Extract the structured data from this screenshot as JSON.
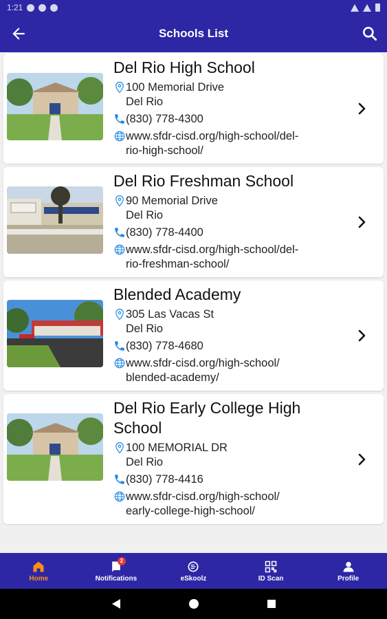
{
  "status_bar": {
    "time": "1:21"
  },
  "header": {
    "title": "Schools List"
  },
  "schools": [
    {
      "name": "Del Rio High School",
      "address_line1": "100 Memorial Drive",
      "address_line2": "Del Rio",
      "phone": "(830) 778-4300",
      "website_line1": "www.sfdr-cisd.org/high-school/del-",
      "website_line2": "rio-high-school/"
    },
    {
      "name": "Del Rio Freshman School",
      "address_line1": "90 Memorial Drive",
      "address_line2": "Del Rio",
      "phone": "(830) 778-4400",
      "website_line1": "www.sfdr-cisd.org/high-school/del-",
      "website_line2": "rio-freshman-school/"
    },
    {
      "name": "Blended Academy",
      "address_line1": "305 Las Vacas St",
      "address_line2": "Del Rio",
      "phone": "(830) 778-4680",
      "website_line1": "www.sfdr-cisd.org/high-school/",
      "website_line2": "blended-academy/"
    },
    {
      "name": "Del Rio Early College High School",
      "address_line1": "100 MEMORIAL DR",
      "address_line2": "Del Rio",
      "phone": "(830) 778-4416",
      "website_line1": "www.sfdr-cisd.org/high-school/",
      "website_line2": "early-college-high-school/"
    }
  ],
  "bottom_nav": [
    {
      "label": "Home",
      "icon": "home-icon",
      "active": true
    },
    {
      "label": "Notifications",
      "icon": "notifications-icon",
      "badge": "2"
    },
    {
      "label": "eSkoolz",
      "icon": "eskoolz-icon"
    },
    {
      "label": "ID Scan",
      "icon": "qr-scan-icon"
    },
    {
      "label": "Profile",
      "icon": "profile-icon"
    }
  ],
  "colors": {
    "primary": "#2d27a6",
    "active_tab": "#ff8c1a",
    "icon_blue": "#1e88e5"
  }
}
